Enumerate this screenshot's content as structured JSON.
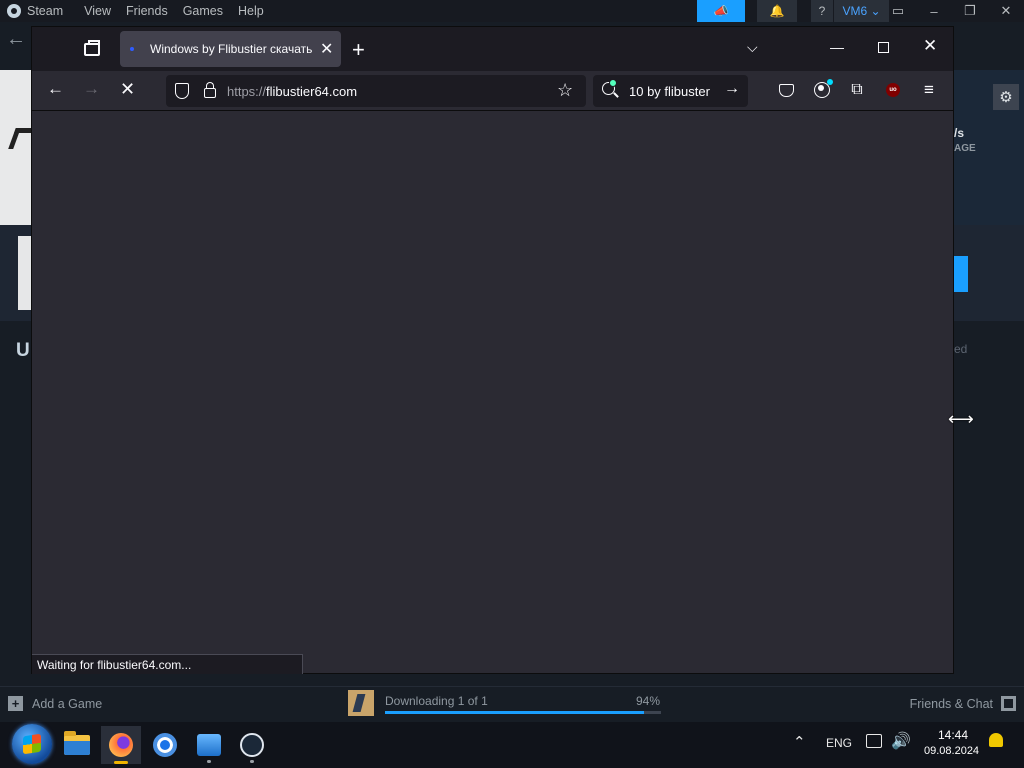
{
  "steam": {
    "menu": [
      "Steam",
      "View",
      "Friends",
      "Games",
      "Help"
    ],
    "help_label": "?",
    "account_label": "VM6 ⌄",
    "window_controls": [
      "–",
      "❐",
      "✕"
    ],
    "download_speed": "/s",
    "download_speed_sub": "AGE",
    "section_letter": "U",
    "status_fragment": "ed",
    "add_game_label": "Add a Game",
    "download_status": "Downloading 1 of 1",
    "download_percent": "94%",
    "download_progress": 0.94,
    "friends_chat_label": "Friends & Chat",
    "accent_color": "#1a9fff"
  },
  "firefox": {
    "tab_title": "Windows by Flibustier скачать",
    "url_protocol": "https://",
    "url_host": "flibustier64.com",
    "suggestion_text": "10 by flibuster",
    "status_text": "Waiting for flibustier64.com...",
    "ublock_label": "uo"
  },
  "taskbar": {
    "language": "ENG",
    "time": "14:44",
    "date": "09.08.2024",
    "apps": [
      "file-explorer",
      "firefox",
      "chrome",
      "media-player",
      "steam"
    ]
  }
}
